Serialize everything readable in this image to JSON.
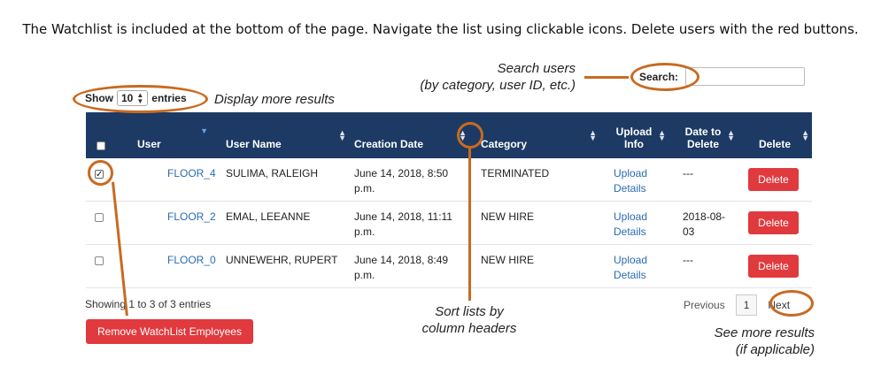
{
  "instruction": "The Watchlist is included at the bottom of the page. Navigate the list using clickable icons. Delete users with the red buttons.",
  "callouts": {
    "search_line1": "Search users",
    "search_line2": "(by category, user ID, etc.)",
    "display_more": "Display more results",
    "sort_line1": "Sort lists by",
    "sort_line2": "column headers",
    "see_more_line1": "See more results",
    "see_more_line2": "(if applicable)"
  },
  "length_control": {
    "show_label": "Show",
    "value": "10",
    "entries_label": "entries"
  },
  "search": {
    "label": "Search:",
    "value": ""
  },
  "columns": {
    "user": "User",
    "user_name": "User Name",
    "creation_date": "Creation Date",
    "category": "Category",
    "upload_info_1": "Upload",
    "upload_info_2": "Info",
    "date_to_delete_1": "Date to",
    "date_to_delete_2": "Delete",
    "delete": "Delete"
  },
  "rows": [
    {
      "checked": true,
      "user": "FLOOR_4",
      "user_name": "SULIMA, RALEIGH",
      "created_1": "June 14, 2018, 8:50",
      "created_2": "p.m.",
      "category": "TERMINATED",
      "upload_1": "Upload",
      "upload_2": "Details",
      "delete_date_1": "---",
      "delete_date_2": "",
      "delete_label": "Delete"
    },
    {
      "checked": false,
      "user": "FLOOR_2",
      "user_name": "EMAL, LEEANNE",
      "created_1": "June 14, 2018, 11:11",
      "created_2": "p.m.",
      "category": "NEW HIRE",
      "upload_1": "Upload",
      "upload_2": "Details",
      "delete_date_1": "2018-08-",
      "delete_date_2": "03",
      "delete_label": "Delete"
    },
    {
      "checked": false,
      "user": "FLOOR_0",
      "user_name": "UNNEWEHR, RUPERT",
      "created_1": "June 14, 2018, 8:49",
      "created_2": "p.m.",
      "category": "NEW HIRE",
      "upload_1": "Upload",
      "upload_2": "Details",
      "delete_date_1": "---",
      "delete_date_2": "",
      "delete_label": "Delete"
    }
  ],
  "info": "Showing 1 to 3 of 3 entries",
  "remove_button": "Remove WatchList Employees",
  "pagination": {
    "previous": "Previous",
    "page": "1",
    "next": "Next"
  },
  "colors": {
    "header_bg": "#1c3a64",
    "delete_red": "#e03a3e",
    "annotation_orange": "#c86a20",
    "link_blue": "#2a6bb0"
  }
}
